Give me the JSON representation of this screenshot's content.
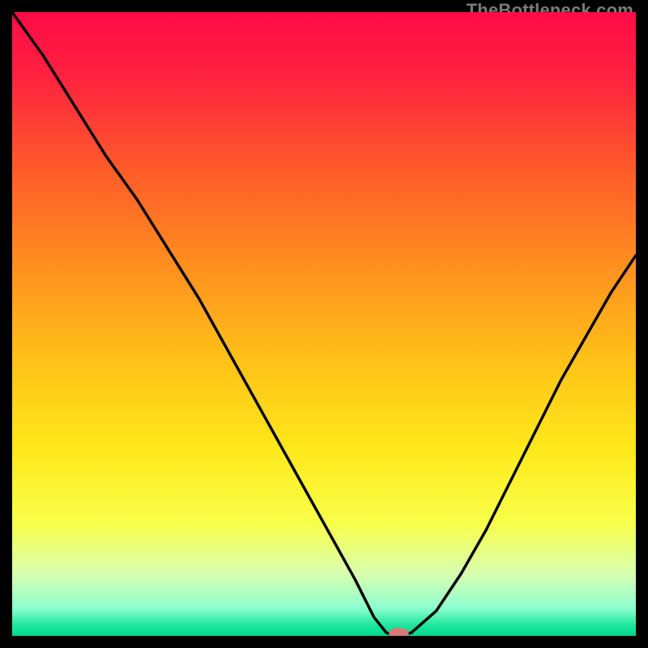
{
  "watermark": "TheBottleneck.com",
  "colors": {
    "gradient_stops": [
      {
        "offset": 0.0,
        "color": "#ff0b47"
      },
      {
        "offset": 0.1,
        "color": "#ff2140"
      },
      {
        "offset": 0.25,
        "color": "#ff5a2a"
      },
      {
        "offset": 0.4,
        "color": "#ff8d1f"
      },
      {
        "offset": 0.55,
        "color": "#ffbf18"
      },
      {
        "offset": 0.7,
        "color": "#ffe81a"
      },
      {
        "offset": 0.82,
        "color": "#f8ff4a"
      },
      {
        "offset": 0.9,
        "color": "#d9ffb0"
      },
      {
        "offset": 0.955,
        "color": "#8effce"
      },
      {
        "offset": 0.985,
        "color": "#18e49a"
      },
      {
        "offset": 1.0,
        "color": "#00d98c"
      }
    ],
    "curve": "#000000",
    "marker_fill": "#d77b78",
    "frame": "#000000"
  },
  "chart_data": {
    "type": "line",
    "title": "",
    "xlabel": "",
    "ylabel": "",
    "xlim": [
      0,
      100
    ],
    "ylim": [
      0,
      100
    ],
    "optimum_x": 62,
    "series": [
      {
        "name": "bottleneck-curve",
        "x": [
          0,
          5,
          10,
          15,
          20,
          25,
          30,
          35,
          40,
          45,
          50,
          55,
          58,
          60,
          62,
          64,
          68,
          72,
          76,
          80,
          84,
          88,
          92,
          96,
          100
        ],
        "y": [
          100,
          93,
          85,
          77,
          70,
          62,
          54,
          45,
          36,
          27,
          18,
          9,
          3,
          0.5,
          0,
          0.5,
          4,
          10,
          17,
          25,
          33,
          41,
          48,
          55,
          61
        ]
      }
    ],
    "marker": {
      "x": 62,
      "y": 0,
      "rx": 1.6,
      "ry": 0.9
    }
  }
}
